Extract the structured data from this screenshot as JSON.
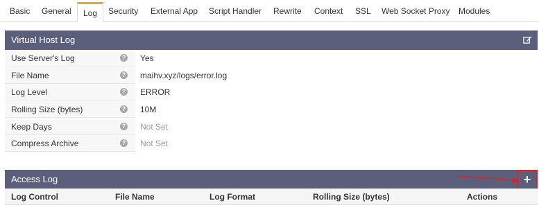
{
  "tabs": [
    {
      "label": "Basic"
    },
    {
      "label": "General"
    },
    {
      "label": "Log"
    },
    {
      "label": "Security"
    },
    {
      "label": "External App"
    },
    {
      "label": "Script Handler"
    },
    {
      "label": "Rewrite"
    },
    {
      "label": "Context"
    },
    {
      "label": "SSL"
    },
    {
      "label": "Web Socket Proxy"
    },
    {
      "label": "Modules"
    }
  ],
  "active_tab": "Log",
  "virtual_host_log": {
    "title": "Virtual Host Log",
    "edit_icon": "edit-icon",
    "rows": [
      {
        "label": "Use Server's Log",
        "value": "Yes"
      },
      {
        "label": "File Name",
        "value": "maihv.xyz/logs/error.log"
      },
      {
        "label": "Log Level",
        "value": "ERROR"
      },
      {
        "label": "Rolling Size (bytes)",
        "value": "10M"
      },
      {
        "label": "Keep Days",
        "value": "Not Set"
      },
      {
        "label": "Compress Archive",
        "value": "Not Set"
      }
    ]
  },
  "access_log": {
    "title": "Access Log",
    "add_icon": "plus-icon",
    "columns": [
      "Log Control",
      "File Name",
      "Log Format",
      "Rolling Size (bytes)",
      "Actions"
    ]
  },
  "colors": {
    "header_bg": "#5b5f7c",
    "active_tab_accent": "#f0a12b",
    "highlight": "#d6242a"
  }
}
